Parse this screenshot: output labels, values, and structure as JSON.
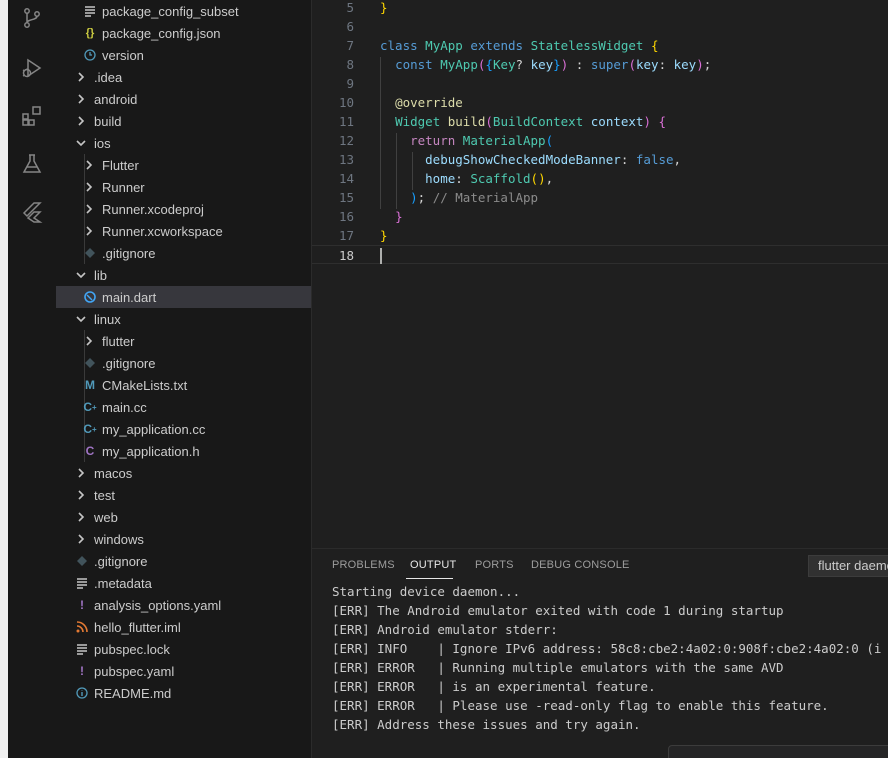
{
  "colors": {
    "keyword": "#569cd6",
    "control_keyword": "#c586c0",
    "type": "#4ec9b0",
    "function": "#dcdcaa",
    "variable": "#9cdcfe",
    "comment": "#8b8b8b",
    "dart_icon": "#42a5f5",
    "json_icon": "#cbcb41",
    "yaml_icon": "#a074c4",
    "cmake_icon": "#519aba",
    "cpp_icon": "#519aba",
    "c_icon": "#a074c4",
    "rss_icon": "#e37933",
    "info_icon": "#519aba"
  },
  "activity_bar": {
    "icons": [
      "source-control-icon",
      "run-debug-icon",
      "extensions-icon",
      "testing-icon",
      "flutter-icon"
    ]
  },
  "explorer": {
    "items": [
      {
        "label": "package_config_subset",
        "icon": "lines-icon"
      },
      {
        "label": "package_config.json",
        "icon": "json-icon"
      },
      {
        "label": "version",
        "icon": "clock-icon"
      },
      {
        "label": ".idea",
        "icon": "chevron-right-icon"
      },
      {
        "label": "android",
        "icon": "chevron-right-icon"
      },
      {
        "label": "build",
        "icon": "chevron-right-icon"
      },
      {
        "label": "ios",
        "icon": "chevron-down-icon"
      },
      {
        "label": "Flutter",
        "icon": "chevron-right-icon"
      },
      {
        "label": "Runner",
        "icon": "chevron-right-icon"
      },
      {
        "label": "Runner.xcodeproj",
        "icon": "chevron-right-icon"
      },
      {
        "label": "Runner.xcworkspace",
        "icon": "chevron-right-icon"
      },
      {
        "label": ".gitignore",
        "icon": "git-icon"
      },
      {
        "label": "lib",
        "icon": "chevron-down-icon"
      },
      {
        "label": "main.dart",
        "icon": "dart-icon"
      },
      {
        "label": "linux",
        "icon": "chevron-down-icon"
      },
      {
        "label": "flutter",
        "icon": "chevron-right-icon"
      },
      {
        "label": ".gitignore",
        "icon": "git-icon"
      },
      {
        "label": "CMakeLists.txt",
        "icon": "cmake-icon"
      },
      {
        "label": "main.cc",
        "icon": "cpp-icon"
      },
      {
        "label": "my_application.cc",
        "icon": "cpp-icon"
      },
      {
        "label": "my_application.h",
        "icon": "c-header-icon"
      },
      {
        "label": "macos",
        "icon": "chevron-right-icon"
      },
      {
        "label": "test",
        "icon": "chevron-right-icon"
      },
      {
        "label": "web",
        "icon": "chevron-right-icon"
      },
      {
        "label": "windows",
        "icon": "chevron-right-icon"
      },
      {
        "label": ".gitignore",
        "icon": "git-icon"
      },
      {
        "label": ".metadata",
        "icon": "lines-icon"
      },
      {
        "label": "analysis_options.yaml",
        "icon": "yaml-icon"
      },
      {
        "label": "hello_flutter.iml",
        "icon": "rss-icon"
      },
      {
        "label": "pubspec.lock",
        "icon": "lines-icon"
      },
      {
        "label": "pubspec.yaml",
        "icon": "yaml-icon"
      },
      {
        "label": "README.md",
        "icon": "info-icon"
      }
    ],
    "selected": "main.dart"
  },
  "editor": {
    "line_numbers": [
      "5",
      "6",
      "7",
      "8",
      "9",
      "10",
      "11",
      "12",
      "13",
      "14",
      "15",
      "16",
      "17",
      "18"
    ],
    "current_line": "18",
    "lines": [
      "}",
      "",
      "class MyApp extends StatelessWidget {",
      "  const MyApp({Key? key}) : super(key: key);",
      "",
      "  @override",
      "  Widget build(BuildContext context) {",
      "    return MaterialApp(",
      "      debugShowCheckedModeBanner: false,",
      "      home: Scaffold(),",
      "    ); // MaterialApp",
      "  }",
      "}",
      ""
    ]
  },
  "panel": {
    "tabs": [
      "PROBLEMS",
      "OUTPUT",
      "PORTS",
      "DEBUG CONSOLE"
    ],
    "active_tab": "OUTPUT",
    "channel": "flutter daemon",
    "output": [
      "Starting device daemon...",
      "[ERR] The Android emulator exited with code 1 during startup",
      "[ERR] Android emulator stderr:",
      "[ERR] INFO    | Ignore IPv6 address: 58c8:cbe2:4a02:0:908f:cbe2:4a02:0 (i",
      "[ERR] ERROR   | Running multiple emulators with the same AVD",
      "[ERR] ERROR   | is an experimental feature.",
      "[ERR] ERROR   | Please use -read-only flag to enable this feature.",
      "[ERR] Address these issues and try again."
    ]
  }
}
